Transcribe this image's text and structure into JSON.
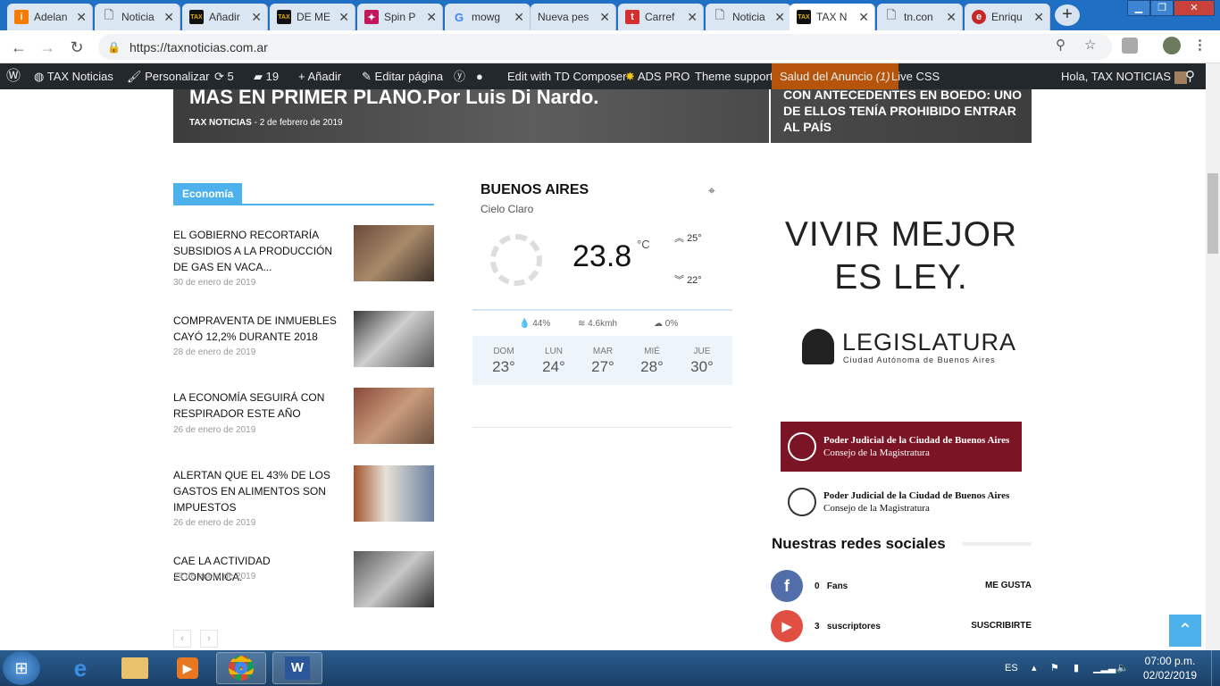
{
  "browser": {
    "tabs": [
      {
        "title": "Adelan",
        "favicon": "i",
        "color": "#f57c00"
      },
      {
        "title": "Noticia",
        "favicon": "doc",
        "color": "#888888"
      },
      {
        "title": "Añadir",
        "favicon": "tax",
        "color": "#111111"
      },
      {
        "title": "DE ME",
        "favicon": "tax",
        "color": "#111111"
      },
      {
        "title": "Spin P",
        "favicon": "spin",
        "color": "#c2185b"
      },
      {
        "title": "mowg",
        "favicon": "G",
        "color": "#4285f4"
      },
      {
        "title": "Nueva pes",
        "favicon": "",
        "color": ""
      },
      {
        "title": "Carref",
        "favicon": "t",
        "color": "#d32f2f"
      },
      {
        "title": "Noticia",
        "favicon": "doc",
        "color": "#888888"
      },
      {
        "title": "TAX N",
        "favicon": "tax",
        "color": "#111111",
        "active": true
      },
      {
        "title": "tn.con",
        "favicon": "doc",
        "color": "#888888"
      },
      {
        "title": "Enriqu",
        "favicon": "e",
        "color": "#c62828"
      }
    ],
    "url": "https://taxnoticias.com.ar"
  },
  "wp_admin_bar": {
    "site_name": "TAX Noticias",
    "customize": "Personalizar",
    "updates_count": "5",
    "comments_count": "19",
    "add_new": "Añadir",
    "edit_page": "Editar página",
    "td_composer": "Edit with TD Composer",
    "ads_pro": "ADS PRO",
    "theme_support": "Theme support",
    "ad_health": "Salud del Anuncio",
    "ad_health_count": "(1)",
    "live_css": "Live CSS",
    "greeting": "Hola, TAX NOTICIAS"
  },
  "hero": {
    "main_title": "MAS EN PRIMER PLANO.Por Luis Di Nardo.",
    "main_author": "TAX NOTICIAS",
    "main_date": "2 de febrero de 2019",
    "side_title": "CON ANTECEDENTES EN BOEDO: UNO DE ELLOS TENÍA PROHIBIDO ENTRAR AL PAÍS"
  },
  "economia": {
    "section_title": "Economía",
    "articles": [
      {
        "title": "EL GOBIERNO RECORTARÍA SUBSIDIOS A LA PRODUCCIÓN DE GAS EN VACA...",
        "date": "30 de enero de 2019"
      },
      {
        "title": "COMPRAVENTA DE INMUEBLES CAYÓ 12,2% DURANTE 2018",
        "date": "28 de enero de 2019"
      },
      {
        "title": "LA ECONOMÍA SEGUIRÁ CON RESPIRADOR ESTE AÑO",
        "date": "26 de enero de 2019"
      },
      {
        "title": "ALERTAN QUE EL 43% DE LOS GASTOS EN ALIMENTOS SON IMPUESTOS",
        "date": "26 de enero de 2019"
      },
      {
        "title": "CAE LA ACTIVIDAD ECONOMICA.",
        "date": "24 de enero de 2019"
      }
    ],
    "prev": "‹",
    "next": "›"
  },
  "weather": {
    "city": "BUENOS AIRES",
    "condition": "Cielo Claro",
    "temp": "23.8",
    "unit": "°C",
    "high": "25°",
    "low": "22°",
    "humidity": "44%",
    "wind": "4.6kmh",
    "clouds": "0%",
    "forecast": [
      {
        "day": "DOM",
        "temp": "23°"
      },
      {
        "day": "LUN",
        "temp": "24°"
      },
      {
        "day": "MAR",
        "temp": "27°"
      },
      {
        "day": "MIÉ",
        "temp": "28°"
      },
      {
        "day": "JUE",
        "temp": "30°"
      }
    ]
  },
  "ads": {
    "banner_line1": "VIVIR MEJOR",
    "banner_line2": "ES LEY.",
    "legislatura": "LEGISLATURA",
    "legislatura_sub": "Ciudad Autónoma de Buenos Aires",
    "pj_title": "Poder Judicial de la Ciudad de Buenos Aires",
    "pj_sub": "Consejo de la Magistratura"
  },
  "social": {
    "heading": "Nuestras redes sociales",
    "rows": [
      {
        "count": "0",
        "label": "Fans",
        "action": "ME GUSTA"
      },
      {
        "count": "3",
        "label": "suscriptores",
        "action": "SUSCRIBIRTE"
      }
    ]
  },
  "taskbar": {
    "language": "ES",
    "time": "07:00 p.m.",
    "date": "02/02/2019"
  }
}
